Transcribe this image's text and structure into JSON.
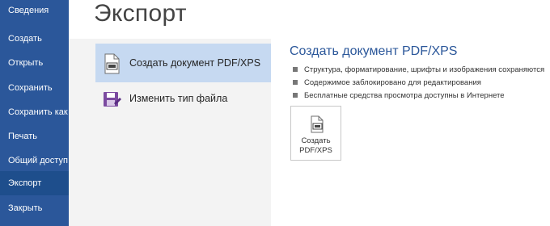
{
  "nav": {
    "items": [
      {
        "label": "Сведения",
        "active": false
      },
      {
        "label": "Создать",
        "active": false
      },
      {
        "label": "Открыть",
        "active": false
      },
      {
        "label": "Сохранить",
        "active": false
      },
      {
        "label": "Сохранить как",
        "active": false
      },
      {
        "label": "Печать",
        "active": false
      },
      {
        "label": "Общий доступ",
        "active": false
      },
      {
        "label": "Экспорт",
        "active": true
      },
      {
        "label": "Закрыть",
        "active": false
      }
    ]
  },
  "page": {
    "title": "Экспорт"
  },
  "options": [
    {
      "label": "Создать документ PDF/XPS",
      "icon": "pdf-document-icon",
      "selected": true
    },
    {
      "label": "Изменить тип файла",
      "icon": "save-file-icon",
      "selected": false
    }
  ],
  "detail": {
    "title": "Создать документ PDF/XPS",
    "bullets": [
      "Структура, форматирование, шрифты и изображения сохраняются",
      "Содержимое заблокировано для редактирования",
      "Бесплатные средства просмотра доступны в Интернете"
    ],
    "button_label": "Создать\nPDF/XPS"
  },
  "colors": {
    "sidebar": "#2b579a",
    "sidebar_active": "#1e4e8c",
    "selected_option": "#c6d9f1",
    "accent_text": "#2b579a"
  }
}
